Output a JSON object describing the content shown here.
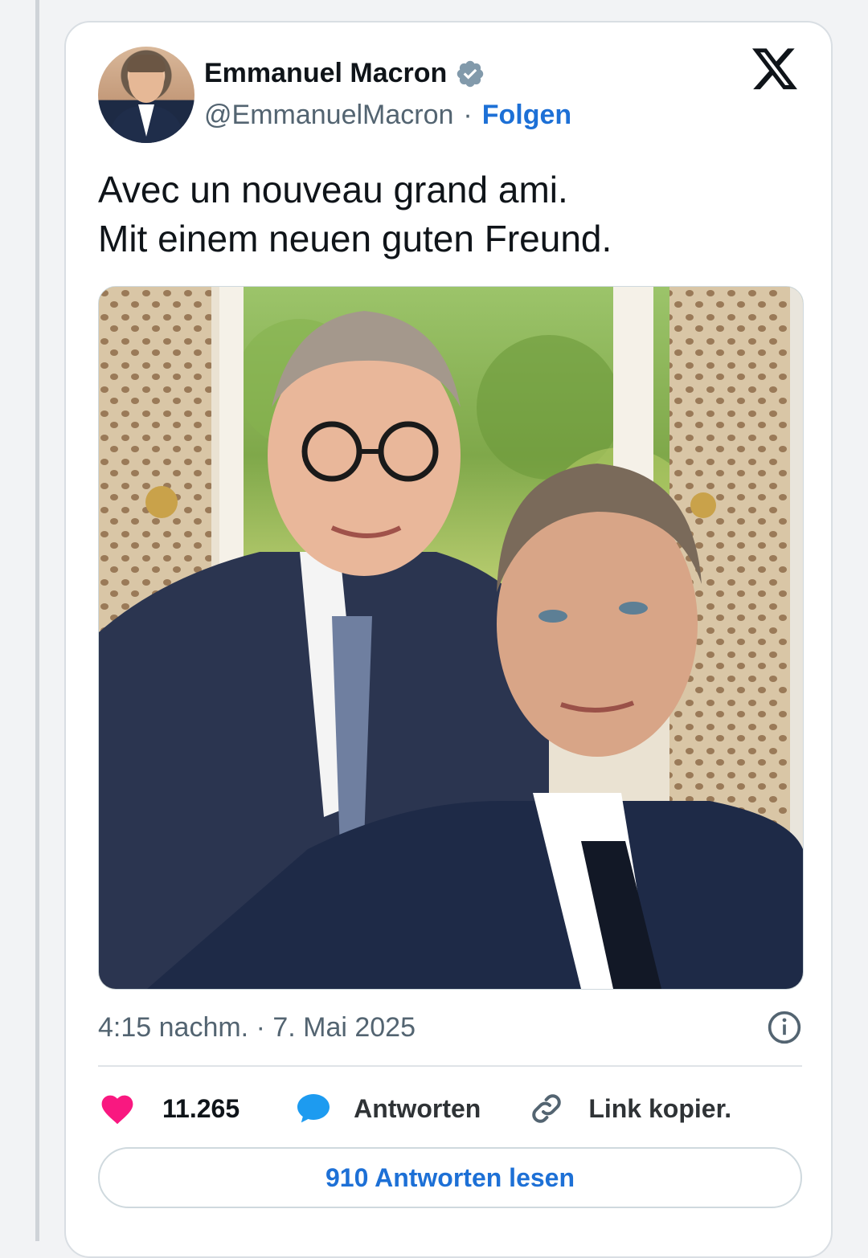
{
  "tweet": {
    "author_name": "Emmanuel Macron",
    "handle": "@EmmanuelMacron",
    "separator": "·",
    "follow_label": "Folgen",
    "text_line1": "Avec un nouveau grand ami.",
    "text_line2": "Mit einem neuen guten Freund.",
    "timestamp": "4:15 nachm. · 7. Mai 2025",
    "likes_count": "11.265",
    "reply_label": "Antworten",
    "copy_link_label": "Link kopier.",
    "read_replies_label": "910 Antworten lesen"
  },
  "icons": {
    "verified": "verified-badge-icon",
    "platform": "x-logo-icon",
    "info": "info-icon",
    "like": "heart-icon",
    "reply": "speech-bubble-icon",
    "copy": "link-icon"
  },
  "colors": {
    "accent_blue": "#1d70d6",
    "like_pink": "#f91880",
    "reply_blue": "#1d9bf0",
    "muted_text": "#536471",
    "verified_gray": "#829aab"
  }
}
